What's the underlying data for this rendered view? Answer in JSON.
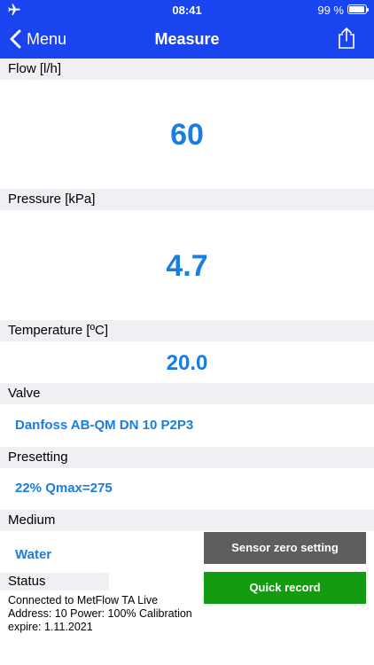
{
  "status_bar": {
    "time": "08:41",
    "battery": "99 %",
    "airplane_icon": "airplane-icon"
  },
  "nav": {
    "back_label": "Menu",
    "title": "Measure",
    "share_icon": "share-icon"
  },
  "flow": {
    "label": "Flow [l/h]",
    "value": "60"
  },
  "pressure": {
    "label": "Pressure [kPa]",
    "value": "4.7"
  },
  "temperature": {
    "label": "Temperature [ºC]",
    "value": "20.0"
  },
  "valve": {
    "label": "Valve",
    "value": "Danfoss AB-QM DN 10 P2P3"
  },
  "presetting": {
    "label": "Presetting",
    "value": "22% Qmax=275"
  },
  "medium": {
    "label": "Medium",
    "value": "Water"
  },
  "buttons": {
    "sensor_zero": "Sensor zero setting",
    "quick_record": "Quick record"
  },
  "status": {
    "label": "Status",
    "line1": "Connected to MetFlow TA Live",
    "line2": "Address: 10 Power: 100% Calibration",
    "line3": "expire: 1.11.2021"
  },
  "colors": {
    "header_blue": "#1a44f0",
    "value_blue": "#1a7de2",
    "button_gray": "#5e5e5e",
    "button_green": "#149c11"
  }
}
